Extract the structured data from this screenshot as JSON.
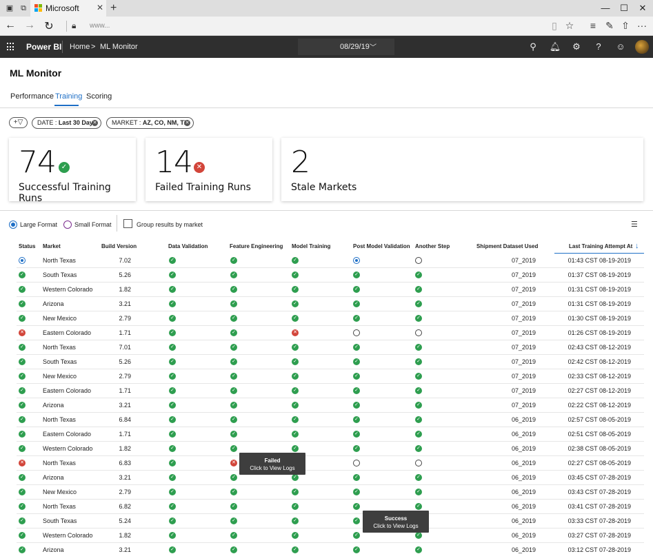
{
  "browser": {
    "tab_title": "Microsoft",
    "url": "www...",
    "tab_close": "✕",
    "new_tab": "+"
  },
  "header": {
    "brand": "Power BI",
    "breadcrumb": [
      "Home",
      "ML Monitor"
    ],
    "breadcrumb_sep": ">",
    "date": "08/29/19"
  },
  "page": {
    "title": "ML Monitor",
    "tabs": [
      "Performance",
      "Training",
      "Scoring"
    ],
    "active_tab": "Training"
  },
  "filters": [
    {
      "key": "DATE : ",
      "value": "Last 30 Days"
    },
    {
      "key": "MARKET : ",
      "value": "AZ, CO, NM, TX"
    }
  ],
  "kpis": [
    {
      "value": "74",
      "label": "Successful Training Runs",
      "badge": "success"
    },
    {
      "value": "14",
      "label": "Failed Training Runs",
      "badge": "failed"
    },
    {
      "value": "2",
      "label": "Stale Markets",
      "badge": ""
    }
  ],
  "options": {
    "large_format": "Large Format",
    "small_format": "Small Format",
    "group_by_market": "Group results by market",
    "selected_format": "Large Format"
  },
  "table": {
    "columns": [
      "Status",
      "Market",
      "Build Version",
      "Data Validation",
      "Feature Engineering",
      "Model Training",
      "Post Model Validation",
      "Another Step",
      "Shipment Dataset Used",
      "Last Training Attempt At"
    ],
    "sort_column": "Last Training Attempt At",
    "sort_direction": "descending",
    "rows": [
      {
        "status": "running",
        "market": "North Texas",
        "build": "7.02",
        "dv": "success",
        "fe": "success",
        "mt": "success",
        "pmv": "running",
        "as": "pending",
        "dataset": "07_2019",
        "time": "01:43 CST  08-19-2019"
      },
      {
        "status": "success",
        "market": "South Texas",
        "build": "5.26",
        "dv": "success",
        "fe": "success",
        "mt": "success",
        "pmv": "success",
        "as": "success",
        "dataset": "07_2019",
        "time": "01:37 CST  08-19-2019"
      },
      {
        "status": "success",
        "market": "Western Colorado",
        "build": "1.82",
        "dv": "success",
        "fe": "success",
        "mt": "success",
        "pmv": "success",
        "as": "success",
        "dataset": "07_2019",
        "time": "01:31 CST  08-19-2019"
      },
      {
        "status": "success",
        "market": "Arizona",
        "build": "3.21",
        "dv": "success",
        "fe": "success",
        "mt": "success",
        "pmv": "success",
        "as": "success",
        "dataset": "07_2019",
        "time": "01:31 CST  08-19-2019"
      },
      {
        "status": "success",
        "market": "New Mexico",
        "build": "2.79",
        "dv": "success",
        "fe": "success",
        "mt": "success",
        "pmv": "success",
        "as": "success",
        "dataset": "07_2019",
        "time": "01:30 CST  08-19-2019"
      },
      {
        "status": "failed",
        "market": "Eastern Colorado",
        "build": "1.71",
        "dv": "success",
        "fe": "success",
        "mt": "failed",
        "pmv": "pending",
        "as": "pending",
        "dataset": "07_2019",
        "time": "01:26 CST  08-19-2019"
      },
      {
        "status": "success",
        "market": "North Texas",
        "build": "7.01",
        "dv": "success",
        "fe": "success",
        "mt": "success",
        "pmv": "success",
        "as": "success",
        "dataset": "07_2019",
        "time": "02:43 CST  08-12-2019"
      },
      {
        "status": "success",
        "market": "South Texas",
        "build": "5.26",
        "dv": "success",
        "fe": "success",
        "mt": "success",
        "pmv": "success",
        "as": "success",
        "dataset": "07_2019",
        "time": "02:42 CST  08-12-2019"
      },
      {
        "status": "success",
        "market": "New Mexico",
        "build": "2.79",
        "dv": "success",
        "fe": "success",
        "mt": "success",
        "pmv": "success",
        "as": "success",
        "dataset": "07_2019",
        "time": "02:33 CST  08-12-2019"
      },
      {
        "status": "success",
        "market": "Eastern Colorado",
        "build": "1.71",
        "dv": "success",
        "fe": "success",
        "mt": "success",
        "pmv": "success",
        "as": "success",
        "dataset": "07_2019",
        "time": "02:27 CST  08-12-2019"
      },
      {
        "status": "success",
        "market": "Arizona",
        "build": "3.21",
        "dv": "success",
        "fe": "success",
        "mt": "success",
        "pmv": "success",
        "as": "success",
        "dataset": "07_2019",
        "time": "02:22 CST  08-12-2019"
      },
      {
        "status": "success",
        "market": "North Texas",
        "build": "6.84",
        "dv": "success",
        "fe": "success",
        "mt": "success",
        "pmv": "success",
        "as": "success",
        "dataset": "06_2019",
        "time": "02:57 CST  08-05-2019"
      },
      {
        "status": "success",
        "market": "Eastern Colorado",
        "build": "1.71",
        "dv": "success",
        "fe": "success",
        "mt": "success",
        "pmv": "success",
        "as": "success",
        "dataset": "06_2019",
        "time": "02:51 CST  08-05-2019"
      },
      {
        "status": "success",
        "market": "Western Colorado",
        "build": "1.82",
        "dv": "success",
        "fe": "success",
        "mt": "success",
        "pmv": "success",
        "as": "success",
        "dataset": "06_2019",
        "time": "02:38 CST  08-05-2019"
      },
      {
        "status": "failed",
        "market": "North Texas",
        "build": "6.83",
        "dv": "success",
        "fe": "failed",
        "mt": "pending",
        "pmv": "pending",
        "as": "pending",
        "dataset": "06_2019",
        "time": "02:27 CST  08-05-2019"
      },
      {
        "status": "success",
        "market": "Arizona",
        "build": "3.21",
        "dv": "success",
        "fe": "success",
        "mt": "success",
        "pmv": "success",
        "as": "success",
        "dataset": "06_2019",
        "time": "03:45 CST  07-28-2019"
      },
      {
        "status": "success",
        "market": "New Mexico",
        "build": "2.79",
        "dv": "success",
        "fe": "success",
        "mt": "success",
        "pmv": "success",
        "as": "success",
        "dataset": "06_2019",
        "time": "03:43 CST  07-28-2019"
      },
      {
        "status": "success",
        "market": "North Texas",
        "build": "6.82",
        "dv": "success",
        "fe": "success",
        "mt": "success",
        "pmv": "success",
        "as": "success",
        "dataset": "06_2019",
        "time": "03:41 CST  07-28-2019"
      },
      {
        "status": "success",
        "market": "South Texas",
        "build": "5.24",
        "dv": "success",
        "fe": "success",
        "mt": "success",
        "pmv": "success",
        "as": "success",
        "dataset": "06_2019",
        "time": "03:33 CST  07-28-2019"
      },
      {
        "status": "success",
        "market": "Western Colorado",
        "build": "1.82",
        "dv": "success",
        "fe": "success",
        "mt": "success",
        "pmv": "success",
        "as": "success",
        "dataset": "06_2019",
        "time": "03:27 CST  07-28-2019"
      },
      {
        "status": "success",
        "market": "Arizona",
        "build": "3.21",
        "dv": "success",
        "fe": "success",
        "mt": "success",
        "pmv": "success",
        "as": "success",
        "dataset": "06_2019",
        "time": "03:12 CST  07-28-2019"
      }
    ]
  },
  "tooltips": [
    {
      "title": "Failed",
      "subtitle": "Click to View Logs"
    },
    {
      "title": "Success",
      "subtitle": "Click to View Logs"
    }
  ],
  "colors": {
    "accent": "#1e6fc6",
    "success": "#2e9e4f",
    "failed": "#d2453a",
    "header_bg": "#2f2f2f"
  },
  "icons": {
    "success": "check-circle-icon",
    "failed": "x-circle-icon",
    "running": "in-progress-icon",
    "pending": "empty-circle-icon"
  }
}
